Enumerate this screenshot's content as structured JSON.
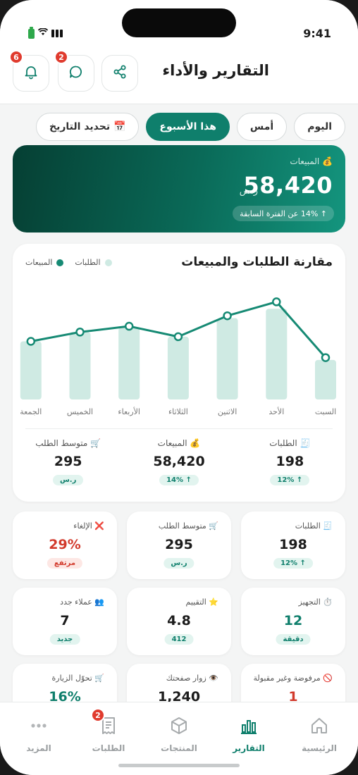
{
  "status": {
    "time": "9:41"
  },
  "header": {
    "title": "التقارير والأداء",
    "notifications_count": "6",
    "messages_count": "2"
  },
  "filters": [
    {
      "label": "اليوم",
      "active": false
    },
    {
      "label": "أمس",
      "active": false
    },
    {
      "label": "هذا الأسبوع",
      "active": true
    },
    {
      "label": "📅 تحديد التاريخ",
      "active": false
    }
  ],
  "sales_card": {
    "label": "💰 المبيعات",
    "value": "58,420",
    "currency": "ر.س",
    "change": "↑ 14% عن الفترة السابقة"
  },
  "chart_data": {
    "type": "bar",
    "title": "مقارنة الطلبات والمبيعات",
    "categories": [
      "السبت",
      "الأحد",
      "الاثنين",
      "الثلاثاء",
      "الأربعاء",
      "الخميس",
      "الجمعة"
    ],
    "series": [
      {
        "name": "الطلبات",
        "type": "bar",
        "color": "#cfeae3",
        "values": [
          34,
          78,
          70,
          54,
          62,
          58,
          50
        ]
      },
      {
        "name": "المبيعات",
        "type": "line",
        "color": "#168a74",
        "values": [
          36,
          84,
          72,
          54,
          63,
          58,
          50
        ]
      }
    ],
    "ylim": [
      0,
      100
    ],
    "legend": "top-left",
    "grid": false
  },
  "chart_summary": [
    {
      "label": "🧾 الطلبات",
      "value": "198",
      "pill": "↑ 12%"
    },
    {
      "label": "💰 المبيعات",
      "value": "58,420",
      "pill": "↑ 14%"
    },
    {
      "label": "🛒 متوسط الطلب",
      "value": "295",
      "pill": "ر.س"
    }
  ],
  "stats": [
    {
      "label": "🧾 الطلبات",
      "value": "198",
      "pill": "↑ 12%",
      "tone": "normal"
    },
    {
      "label": "🛒 متوسط الطلب",
      "value": "295",
      "pill": "ر.س",
      "tone": "normal"
    },
    {
      "label": "❌ الإلغاء",
      "value": "29%",
      "pill": "مرتفع",
      "tone": "red"
    },
    {
      "label": "⏱️ التجهيز",
      "value": "12",
      "pill": "دقيقة",
      "tone": "green"
    },
    {
      "label": "⭐ التقييم",
      "value": "4.8",
      "pill": "412",
      "tone": "normal"
    },
    {
      "label": "👥 عملاء جدد",
      "value": "7",
      "pill": "جديد",
      "tone": "normal"
    },
    {
      "label": "🚫 مرفوضة وغير مقبولة",
      "value": "1",
      "tone": "red"
    },
    {
      "label": "👁️ زوار صفحتك",
      "value": "1,240",
      "tone": "normal"
    },
    {
      "label": "🛒 تحوّل الزيارة",
      "value": "16%",
      "tone": "green"
    }
  ],
  "tabbar": {
    "items": [
      {
        "label": "الرئيسية",
        "icon": "home-icon",
        "active": false
      },
      {
        "label": "التقارير",
        "icon": "bar-chart-icon",
        "active": true
      },
      {
        "label": "المنتجات",
        "icon": "box-icon",
        "active": false
      },
      {
        "label": "الطلبات",
        "icon": "receipt-icon",
        "active": false,
        "badge": "2"
      },
      {
        "label": "المزيد",
        "icon": "more-icon",
        "active": false
      }
    ]
  },
  "colors": {
    "accent": "#0f7f6c",
    "danger": "#e03b2e"
  }
}
